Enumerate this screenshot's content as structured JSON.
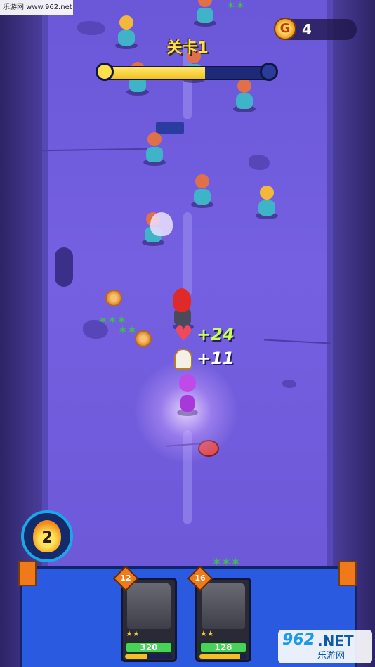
{
  "watermark": {
    "top_text": "乐游网 www.962.net",
    "bottom_number": "962",
    "bottom_net": ".NET",
    "bottom_cn": "乐游网"
  },
  "hud": {
    "level_label": "关卡1",
    "level_progress": 0.6,
    "coins": "4",
    "coin_icon": "G"
  },
  "pickups": {
    "health_gain": "+24",
    "ammo_gain": "+11"
  },
  "ability": {
    "charges": "2",
    "icon": "flame-icon"
  },
  "cards": [
    {
      "level": "12",
      "stars": "★★",
      "hp": "320",
      "progress": 0.45
    },
    {
      "level": "16",
      "stars": "★★",
      "hp": "128",
      "progress": 0.85
    }
  ],
  "colors": {
    "road": "#7460e0",
    "accent_yellow": "#ffe04a",
    "panel_blue": "#2a5ae0",
    "hp_green": "#49d25a"
  }
}
